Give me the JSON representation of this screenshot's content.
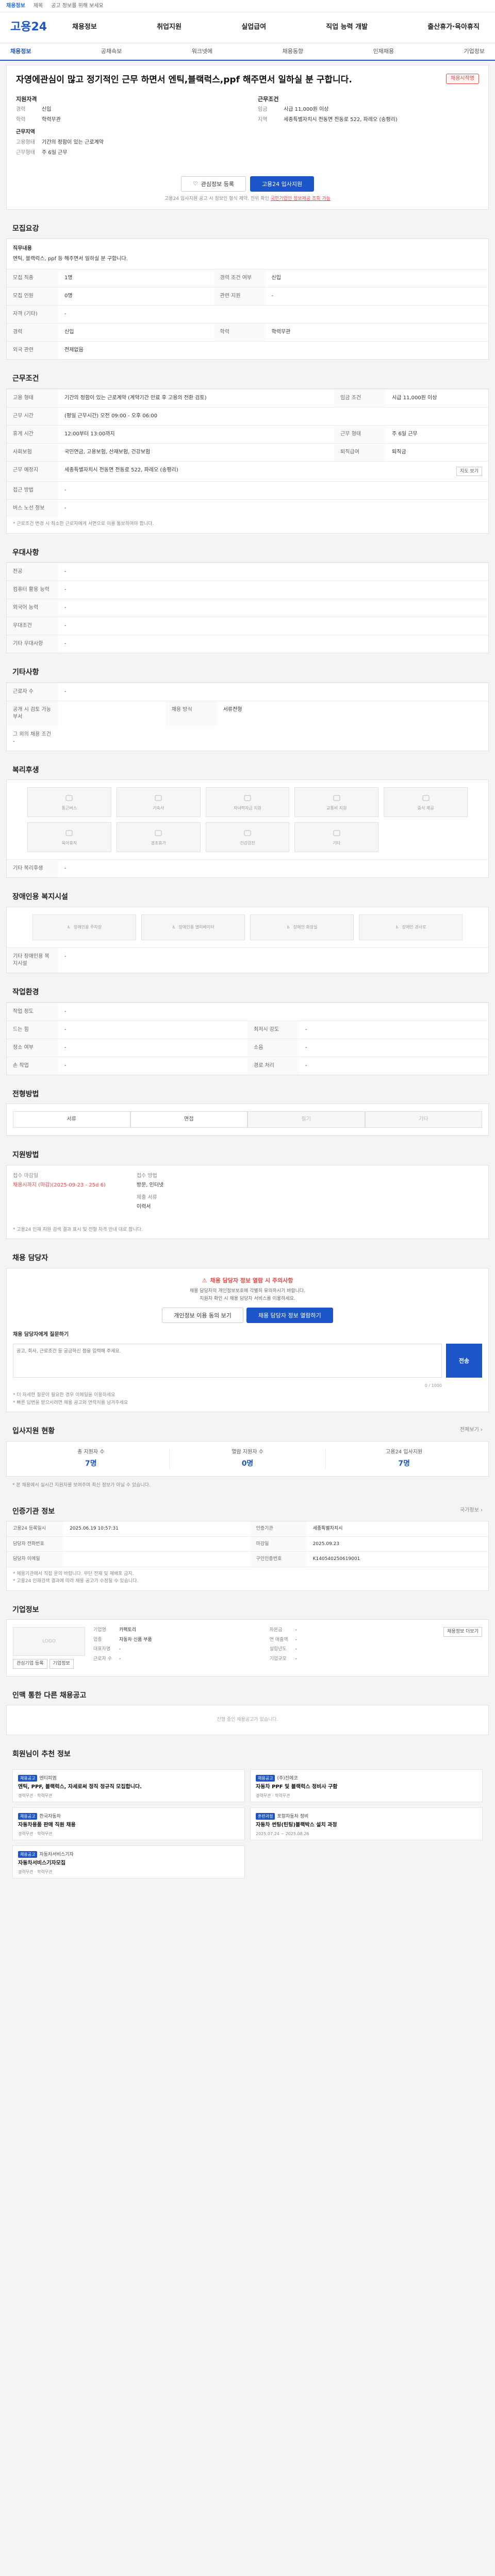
{
  "topbar": {
    "a": "채용정보",
    "b": "제목",
    "c": "공고 정보를 위해 보세요"
  },
  "header": {
    "logo": "고용24",
    "gnb": [
      "채용정보",
      "취업지원",
      "실업급여",
      "직업 능력 개발",
      "출산휴가·육아휴직"
    ]
  },
  "subnav": [
    "채용정보",
    "공채속보",
    "워크넷에",
    "채용동향",
    "인재채용",
    "기업정보"
  ],
  "job": {
    "badge": "채용시작명",
    "title": "자영에관심이 많고 정기적인 근무 하면서 엔틱,블랙럭스,ppf 해주면서 일하실 분 구합니다.",
    "left_title": "지원자격",
    "left": [
      [
        "경력",
        "신입"
      ],
      [
        "학력",
        "학력무관"
      ],
      [
        "",
        "근무지역"
      ],
      [
        "고용형태",
        "기간의 정함이 있는 근로계약"
      ],
      [
        "근무형태",
        "주 6일 근무"
      ]
    ],
    "right_title": "근무조건",
    "right": [
      [
        "임금",
        "시급 11,000원 이상"
      ],
      [
        "지역",
        "세종특별자치시 전동면 전동로 522, 파레오 (송평리)"
      ]
    ],
    "btn_save": "관심정보 등록",
    "btn_apply": "고용24 입사지원",
    "note_a": "고용24 입사지원 공고 시 정보인 형식 제약. 진위 확인",
    "note_b": "국민기업인 정보제공 조회 가능"
  },
  "recruit": {
    "title": "모집요강",
    "duty_label": "직무내용",
    "duty": "엔틱, 블랙럭스, ppf 등 해주면서 일하실 분 구합니다.",
    "rows": [
      [
        "모집 직종",
        "1명",
        "경력 조건 여부",
        "신입"
      ],
      [
        "모집 인원",
        "0명",
        "관련 지원",
        "-"
      ],
      [
        "자격 (기타)",
        "-",
        "",
        ""
      ],
      [
        "경력",
        "신입",
        "학력",
        "학력무관"
      ],
      [
        "외국 관련",
        "전제없음",
        "",
        ""
      ]
    ]
  },
  "work": {
    "title": "근무조건",
    "rows": [
      [
        "고용 형태",
        "기간의 정함이 있는 근로계약 (계약기간 만료 후 고용의 전환 검토)",
        "임금 조건",
        "시급 11,000원 이상"
      ],
      [
        "근무 시간",
        "(평일 근무시간) 오전 09:00 - 오후 06:00",
        "",
        ""
      ],
      [
        "휴게 시간",
        "12:00부터 13:00까지",
        "근무 형태",
        "주 6일 근무"
      ],
      [
        "사회보험",
        "국민연금, 고용보험, 산재보험, 건강보험",
        "퇴직급여",
        "퇴직금"
      ],
      [
        "근무 예정지",
        "세종특별자치시 전동면 전동로 522, 파레오 (송평리)",
        "",
        ""
      ],
      [
        "접근 방법",
        "-",
        "",
        ""
      ],
      [
        "버스 노선 정보",
        "-",
        "",
        ""
      ]
    ],
    "map_btn": "지도 보기",
    "note": "* 근로조건 변경 시 최소한 근로자에게 서면으로 이를 통보하여야 합니다."
  },
  "prefer": {
    "title": "우대사항",
    "rows": [
      [
        "전공",
        "-"
      ],
      [
        "컴퓨터 활용 능력",
        "-"
      ],
      [
        "외국어 능력",
        "-"
      ],
      [
        "우대조건",
        "-"
      ],
      [
        "기타 우대사항",
        "-"
      ]
    ]
  },
  "etc": {
    "title": "기타사항",
    "rows": [
      [
        "근로자 수",
        "-"
      ],
      [
        "공개 시 검토 가능 부서",
        "",
        "채용 방식",
        "서류전형"
      ]
    ],
    "extra": "그 외의 채용 조건",
    "extra_val": "-"
  },
  "welfare": {
    "title": "복리후생",
    "items": [
      "통근버스",
      "기숙사",
      "자녀학자금 지원",
      "교통비 지원",
      "중식 제공",
      "육아휴직",
      "경조휴가",
      "건강검진",
      "기타"
    ],
    "etc_label": "기타 복리후생",
    "etc_val": "-"
  },
  "access": {
    "title": "장애인용 복지시설",
    "items": [
      "장애인용 주차장",
      "장애인용 엘리베이터",
      "장애인 화장실",
      "장애인 경사로"
    ],
    "etc_label": "기타 장애인용 복지시설",
    "etc_val": "-"
  },
  "env": {
    "title": "작업환경",
    "rows": [
      [
        "작업 정도",
        "-",
        "",
        ""
      ],
      [
        "드는 힘",
        "-",
        "최저시 강도",
        "-"
      ],
      [
        "청소 여부",
        "-",
        "소음",
        "-"
      ],
      [
        "손 작업",
        "-",
        "경로 처리",
        "-"
      ]
    ]
  },
  "process": {
    "title": "전형방법",
    "steps": [
      "서류",
      "면접",
      "필기",
      "기타"
    ],
    "step_off": [
      false,
      false,
      true,
      true
    ]
  },
  "method": {
    "title": "지원방법",
    "a_k": "접수 마감일",
    "a_v": "채용시까지 (마감)(2025-09-23 - 25d 6)",
    "b_k": "접수 방법",
    "b_v": "방문, 인터넷",
    "c_k": "제출 서류",
    "c_v": "이력서",
    "notes": [
      "* 고용24 인재 지원 검색 결과 표시 및 전형 자격 안내 대로 합니다."
    ]
  },
  "manager": {
    "title": "채용 담당자",
    "alert": "채용 담당자 정보 열람 시 주의사항",
    "desc1": "채용 담당자의 개인정보보호에 각별히 유의하시기 바랍니다.",
    "desc2": "지원자 확인 시 채용 담당자 서비스를 이용하세요.",
    "btn1": "개인정보 이용 동의 보기",
    "btn2": "채용 담당자 정보 열람하기",
    "qa_title": "채용 담당자에게 질문하기",
    "qa_placeholder": "공고, 회사, 근로조건 등 궁금하신 점을 입력해 주세요.",
    "qa_count": "0 / 1000",
    "qa_btn": "전송",
    "qa_notes": [
      "* 더 자세한 질문이 필요한 경우 이메일을 이용하세요",
      "* 빠른 답변을 받으시려면 채용 공고와 연락처를 남겨주세요"
    ]
  },
  "status": {
    "title": "입사지원 현황",
    "link": "전체보기 ›",
    "stats": [
      [
        "총 지원자 수",
        "7명"
      ],
      [
        "열람 지원자 수",
        "0명"
      ],
      [
        "고용24 입사지원",
        "7명"
      ]
    ],
    "note": "* 본 채용에서 실시간 지원자를 보여주며 최신 정보가 아닐 수 있습니다."
  },
  "info": {
    "title": "인증기관 정보",
    "link": "국가정보 ›",
    "rows": [
      [
        "고용24 등록일시",
        "2025.06.19 10:57:31",
        "인증기관",
        "세종특별자치시"
      ],
      [
        "담당자 전화번호",
        "",
        "마감일",
        "2025.09.23"
      ],
      [
        "담당자 이메일",
        "",
        "구인인증번호",
        "K140540250619001"
      ]
    ],
    "notes": [
      "* 채용기관에서 직접 문의 바랍니다. 무단 전재 및 재배포 금지.",
      "* 고용24 인재검색 결과에 따라 채용 공고가 수정될 수 있습니다."
    ]
  },
  "company": {
    "title": "기업정보",
    "logo": "LOGO",
    "btn1": "관심기업 등록",
    "btn2": "기업정보",
    "rows": [
      [
        "기업명",
        "카팩토리"
      ],
      [
        "업종",
        "자동차 신품 부품"
      ],
      [
        "대표자명",
        "-"
      ],
      [
        "근로자 수",
        "-"
      ],
      [
        "자본금",
        "-"
      ],
      [
        "연 매출액",
        "-"
      ],
      [
        "설립년도",
        "-"
      ],
      [
        "기업규모",
        "-"
      ]
    ],
    "detail_btn": "채용정보 더보기"
  },
  "others": {
    "title": "인맥 통한 다른 채용공고",
    "empty": "진행 중인 채용공고가 없습니다."
  },
  "recommend": {
    "title": "회원님이 추천 정보",
    "items": [
      {
        "tag": "채용공고",
        "co": "엔티피엠",
        "t": "엔틱, PPF, 블랙럭스, 자세로써 정직 정규직 모집합니다.",
        "m": "경력무관 · 학력무관"
      },
      {
        "tag": "채용공고",
        "co": "(주)진에코",
        "t": "자동차 PPF 및 블랙럭스 정비사 구함",
        "m": "경력무관 · 학력무관"
      },
      {
        "tag": "채용공고",
        "co": "한국자동차",
        "t": "자동차용품 판매 직원 채용",
        "m": "경력무관 · 학력무관"
      },
      {
        "tag": "훈련과정",
        "co": "포항자동차 정비",
        "t": "자동차 썬팅(틴팅)블랙박스 설치 과정",
        "m": "2025.07.24 ~ 2025.08.26"
      },
      {
        "tag": "채용공고",
        "co": "자동차서비스기자",
        "t": "자동차서비스기자모집",
        "m": "경력무관 · 학력무관"
      }
    ]
  }
}
